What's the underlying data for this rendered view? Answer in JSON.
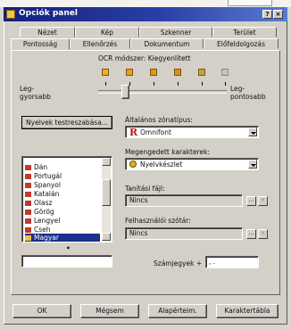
{
  "window": {
    "title": "Opciók panel",
    "help_label": "?",
    "close_label": "×"
  },
  "tabs_row1": [
    "Nézet",
    "Kép",
    "Szkenner",
    "Terület"
  ],
  "tabs_row2": [
    "Pontosság",
    "Ellenőrzés",
    "Dokumentum",
    "Előfeldolgozás"
  ],
  "ocr": {
    "label": "OCR módszer: Kiegyenlített",
    "left_label_1": "Leg-",
    "left_label_2": "gyorsabb",
    "right_label_1": "Leg-",
    "right_label_2": "pontosabb",
    "slider_level_fraction": 0.29,
    "level_icon_count": 6
  },
  "languages": {
    "button_label": "Nyelvek testreszabása...",
    "items": [
      "Dán",
      "Portugál",
      "Spanyol",
      "Katalán",
      "Olasz",
      "Görög",
      "Lengyel",
      "Cseh",
      "Magyar"
    ],
    "selected": "Magyar",
    "dot": "•",
    "input_value": ""
  },
  "font": {
    "label": "Általános zónatípus:",
    "glyph": "R",
    "value": "Omnifont"
  },
  "characters": {
    "label": "Megengedett karakterek:",
    "value": "Nyelvkészlet"
  },
  "training": {
    "label": "Tanítási fájl:",
    "value": "Nincs",
    "browse_label": "...",
    "clear_label": "×"
  },
  "dictionary": {
    "label": "Felhasználói szótár:",
    "value": "Nincs",
    "browse_label": "...",
    "clear_label": "×"
  },
  "digits": {
    "label": "Számjegyek +",
    "value": ", ."
  },
  "buttons": {
    "ok": "OK",
    "cancel": "Mégsem",
    "defaults": "Alapérteim.",
    "char_table": "Karaktertábla"
  },
  "colors": {
    "title_start": "#14207a",
    "title_end": "#5a7ad0",
    "selection": "#1b2f8c",
    "omnifont_r": "#b01818"
  }
}
